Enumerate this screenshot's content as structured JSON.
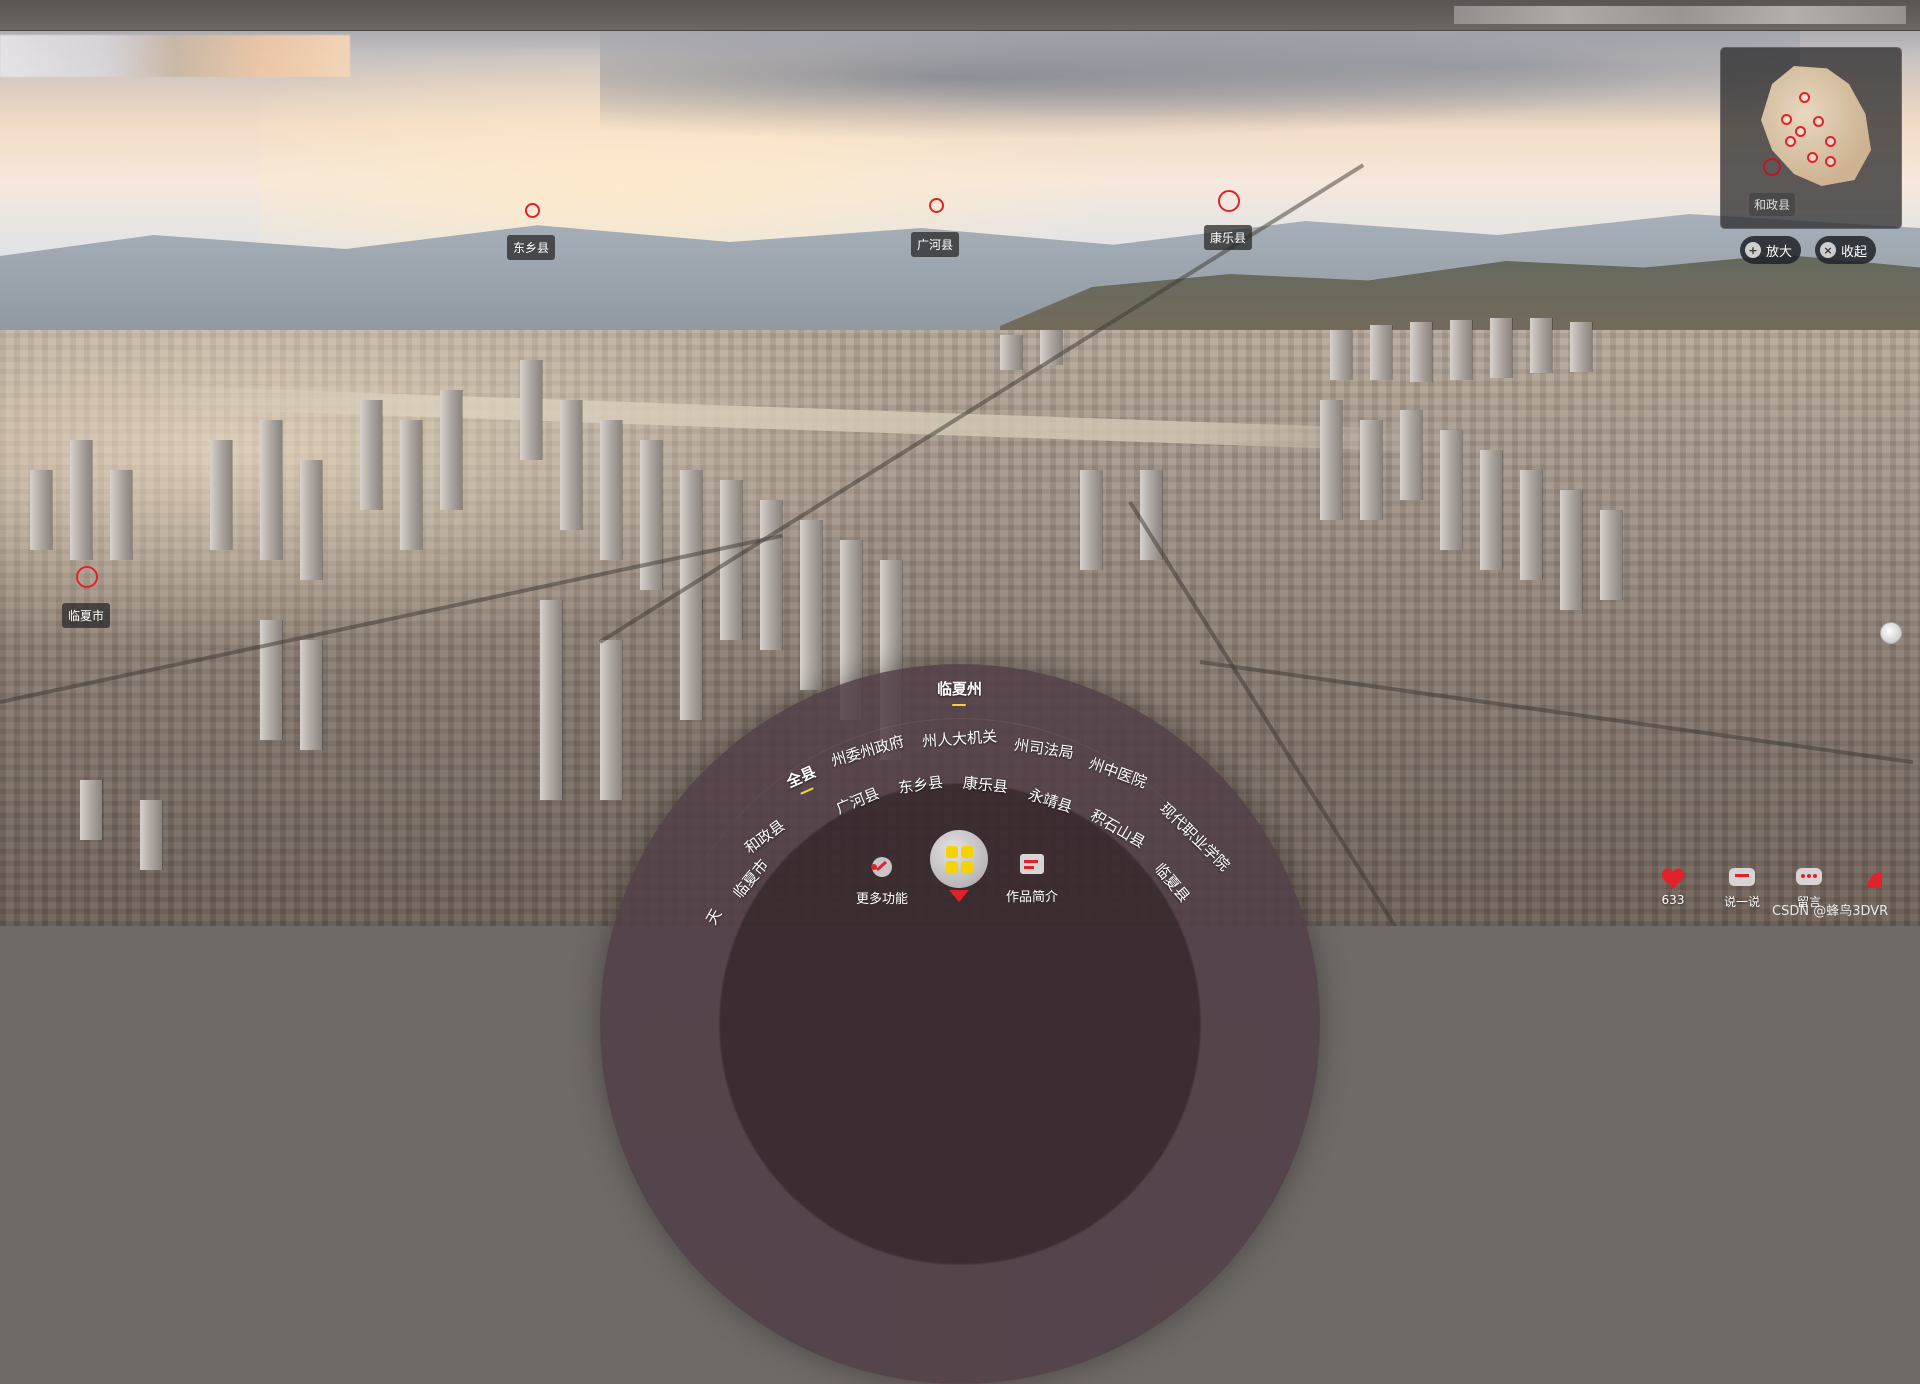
{
  "hotspots": [
    {
      "label": "东乡县"
    },
    {
      "label": "广河县"
    },
    {
      "label": "康乐县"
    },
    {
      "label": "临夏市"
    }
  ],
  "minimap": {
    "label": "和政县",
    "zoom_label": "放大",
    "collapse_label": "收起",
    "zoom_icon": "zoom-in-icon",
    "collapse_icon": "close-icon"
  },
  "menu": {
    "title": "临夏州",
    "row1": [
      "全县",
      "州委州政府",
      "州人大机关",
      "州司法局",
      "州中医院"
    ],
    "row2": [
      "和政县",
      "广河县",
      "东乡县",
      "康乐县",
      "永靖县",
      "积石山县",
      "现代职业学院"
    ],
    "row3": [
      "临夏市",
      "临夏县"
    ],
    "row4_partial": "天",
    "more_label": "更多功能",
    "intro_label": "作品简介"
  },
  "tools": {
    "likes_count": "633",
    "comment_label": "说一说",
    "chat_label": "留言"
  },
  "watermark": "CSDN @蜂鸟3DVR",
  "colors": {
    "hotspot_ring": "#e0232b",
    "accent_underline": "#f5d33a",
    "menu_button": "#f5d200"
  }
}
